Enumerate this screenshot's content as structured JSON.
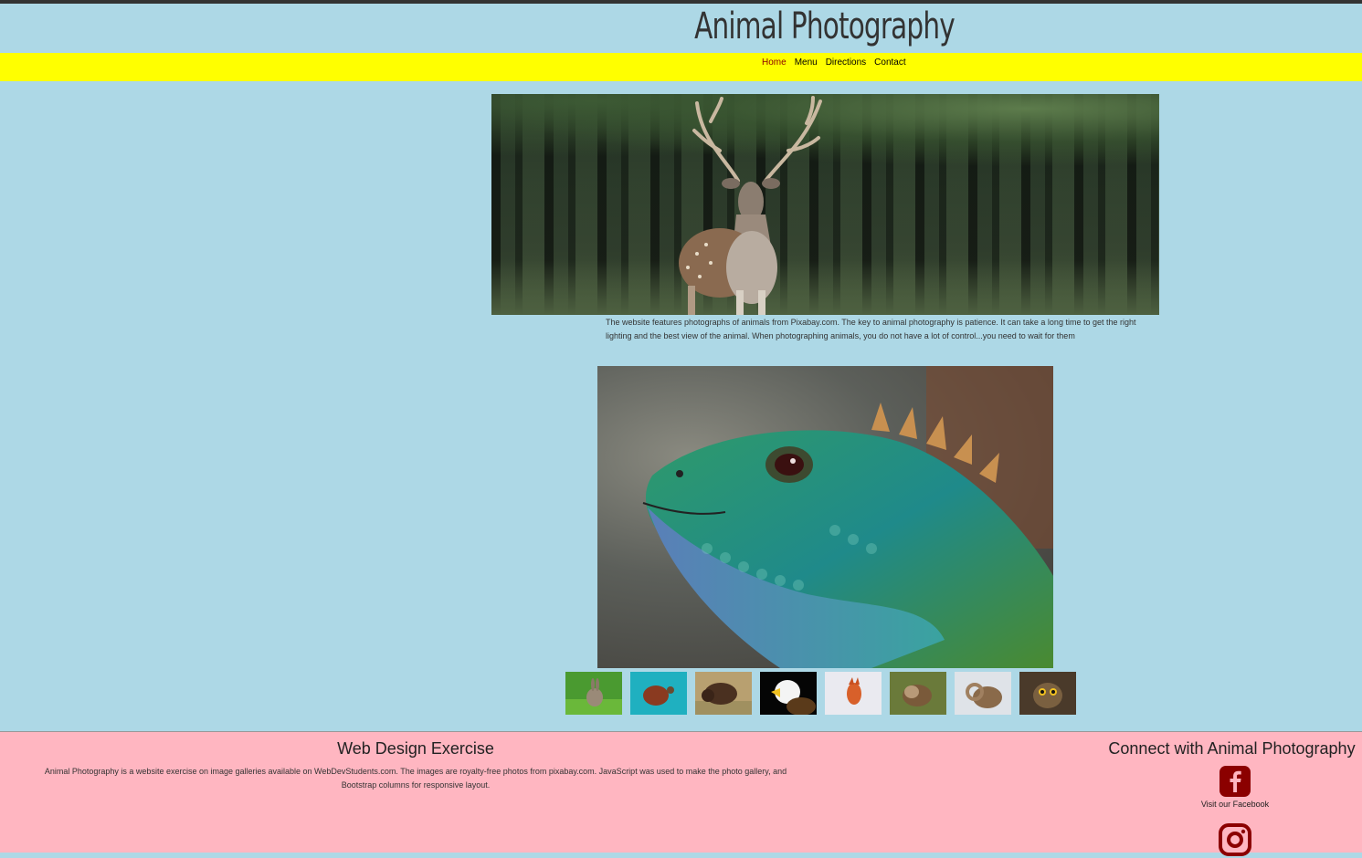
{
  "header": {
    "site_title": "Animal Photography"
  },
  "nav": {
    "items": [
      {
        "label": "Home",
        "active": true
      },
      {
        "label": "Menu",
        "active": false
      },
      {
        "label": "Directions",
        "active": false
      },
      {
        "label": "Contact",
        "active": false
      }
    ]
  },
  "main": {
    "hero_image": "deer-photo",
    "intro": "The website features photographs of animals from Pixabay.com. The key to animal photography is patience. It can take a long time to get the right lighting and the best view of the animal. When photographing animals, you do not have a lot of control...you need to wait for them",
    "gallery_main_image": "iguana-photo",
    "thumbnails": [
      "rabbit",
      "turtle",
      "bison",
      "eagle",
      "fox",
      "otter",
      "ram",
      "owl"
    ]
  },
  "footer": {
    "left_title": "Web Design Exercise",
    "left_text": "Animal Photography is a website exercise on image galleries available on WebDevStudents.com. The images are royalty-free photos from pixabay.com. JavaScript was used to make the photo gallery, and Bootstrap columns for responsive layout.",
    "right_title": "Connect with Animal Photography",
    "facebook_label": "Visit our Facebook",
    "facebook_icon": "facebook-icon",
    "instagram_icon": "instagram-icon"
  },
  "colors": {
    "page_bg": "#add8e6",
    "nav_bg": "#ffff00",
    "footer_bg": "#ffb6c1",
    "active_link": "#8b0000",
    "social_icon": "#8b0000"
  }
}
